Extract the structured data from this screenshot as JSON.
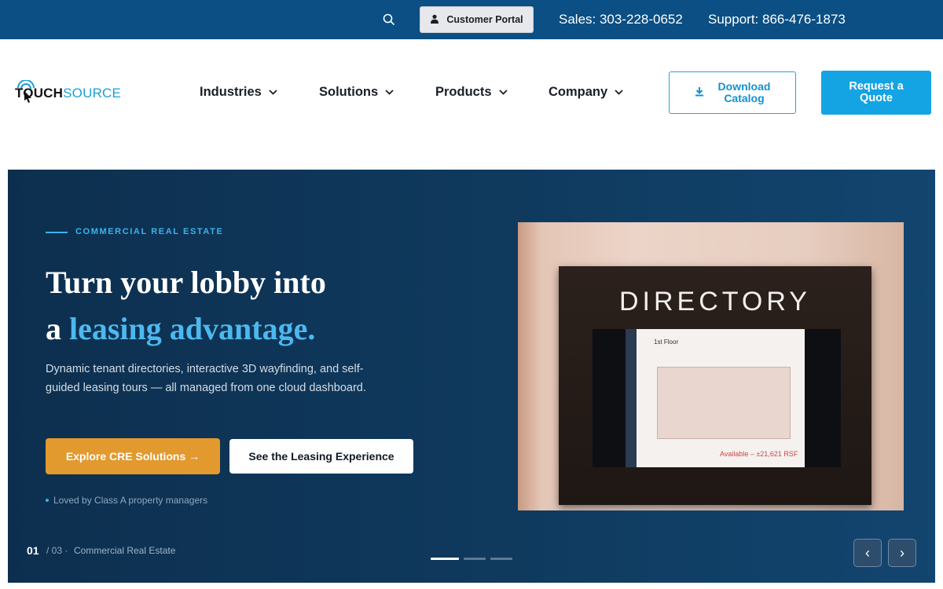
{
  "topbar": {
    "portal_label": "Customer Portal",
    "sales": "Sales: 303-228-0652",
    "support": "Support: 866-476-1873"
  },
  "logo": {
    "part1": "TOUCH",
    "part2": "SOURCE"
  },
  "nav": {
    "items": [
      {
        "label": "Industries"
      },
      {
        "label": "Solutions"
      },
      {
        "label": "Products"
      },
      {
        "label": "Company"
      }
    ],
    "catalog_line1": "Download",
    "catalog_line2": "Catalog",
    "quote_line1": "Request a",
    "quote_line2": "Quote"
  },
  "hero": {
    "eyebrow": "COMMERCIAL REAL ESTATE",
    "title_line1": "Turn your lobby into",
    "title_a": "a",
    "title_accent": "leasing advantage.",
    "description": "Dynamic tenant directories, interactive 3D wayfinding, and self-guided leasing tours — all managed from one cloud dashboard.",
    "primary_cta": "Explore CRE Solutions →",
    "secondary_cta": "See the Leasing Experience",
    "social_proof": "Loved by Class A property managers",
    "slide_current": "01",
    "slide_total": "/ 03 ·",
    "slide_name": "Commercial Real Estate",
    "dots_count": 3,
    "active_dot": 0
  },
  "image": {
    "directory_title": "DIRECTORY",
    "floor_label": "1st Floor",
    "available_text": "Available – ±21,621 RSF"
  },
  "colors": {
    "topbar": "#0b4f84",
    "accent": "#14a3e3",
    "cta_orange": "#e2992e",
    "hero_bg": "#0f3a5e"
  }
}
